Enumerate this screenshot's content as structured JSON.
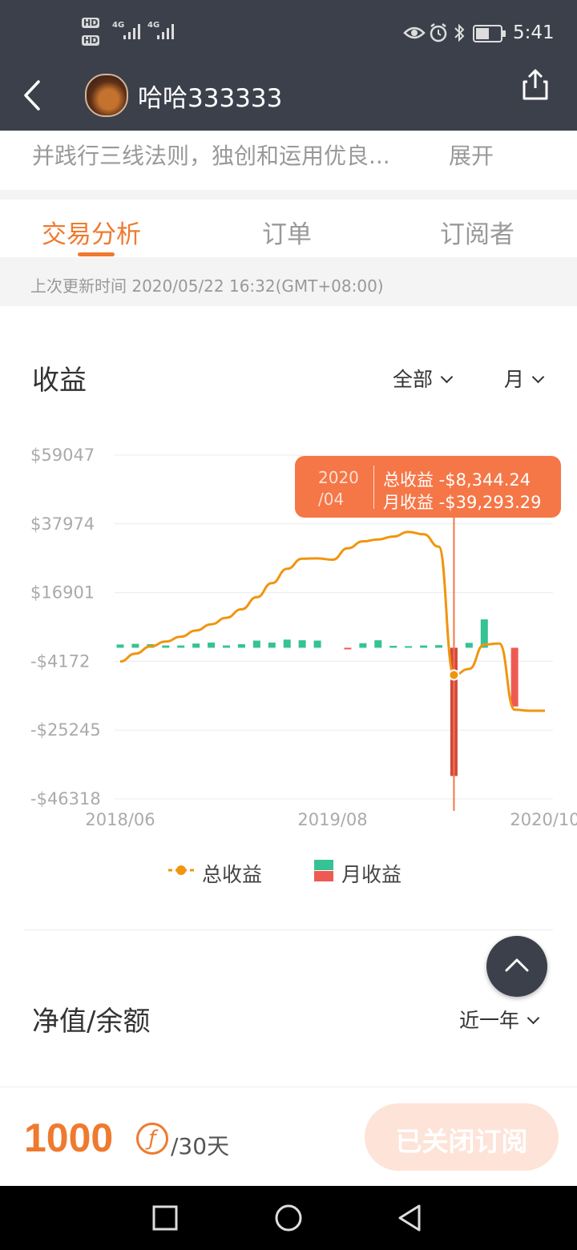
{
  "status_bar": {
    "left_indicators": [
      "HD",
      "HD",
      "4G",
      "4G"
    ],
    "time": "5:41"
  },
  "header": {
    "title": "哈哈333333"
  },
  "profile": {
    "bio_text": "并践行三线法则，独创和运用优良...",
    "expand_label": "展开"
  },
  "tabs": [
    {
      "label": "交易分析",
      "active": true
    },
    {
      "label": "订单",
      "active": false
    },
    {
      "label": "订阅者",
      "active": false
    }
  ],
  "update_info": {
    "text": "上次更新时间 2020/05/22 16:32(GMT+08:00)"
  },
  "earnings": {
    "title": "收益",
    "filter_label": "全部",
    "period_label": "月"
  },
  "colors": {
    "accent": "#ef7a2f",
    "line": "#f0950e",
    "positive": "#35c295",
    "negative": "#ee5a52",
    "header_bg": "#3c404b",
    "tooltip_bg": "#f57647"
  },
  "tooltip": {
    "date_line1": "2020",
    "date_line2": "/04",
    "total_line": "总收益 -$8,344.24",
    "monthly_line": "月收益 -$39,293.29"
  },
  "chart_data": {
    "type": "line",
    "y_ticks": [
      "$59047",
      "$37974",
      "$16901",
      "-$4172",
      "-$25245",
      "-$46318"
    ],
    "y_tick_values": [
      59047,
      37974,
      16901,
      -4172,
      -25245,
      -46318
    ],
    "ylim": [
      -46318,
      59047
    ],
    "x_ticks": [
      "2018/06",
      "2019/08",
      "2020/10"
    ],
    "grid": true,
    "legend_position": "bottom",
    "series": [
      {
        "name": "总收益",
        "kind": "line",
        "color": "#f0950e",
        "x": [
          "2018/06",
          "2018/07",
          "2018/08",
          "2018/09",
          "2018/10",
          "2018/11",
          "2018/12",
          "2019/01",
          "2019/02",
          "2019/03",
          "2019/04",
          "2019/05",
          "2019/06",
          "2019/07",
          "2019/08",
          "2019/09",
          "2019/10",
          "2019/11",
          "2019/12",
          "2020/01",
          "2020/02",
          "2020/03",
          "2020/04",
          "2020/05",
          "2020/06",
          "2020/07",
          "2020/08",
          "2020/09",
          "2020/10"
        ],
        "values": [
          -4200,
          -1800,
          400,
          1900,
          3400,
          5300,
          7200,
          9200,
          11800,
          15500,
          19800,
          24200,
          27300,
          27400,
          27000,
          30500,
          32600,
          33200,
          34100,
          35500,
          34800,
          31000,
          -8344,
          -6500,
          1000,
          1300,
          -19000,
          -19300,
          -19300
        ]
      },
      {
        "name": "月收益",
        "kind": "bar",
        "x": [
          "2018/06",
          "2018/07",
          "2018/08",
          "2018/09",
          "2018/10",
          "2018/11",
          "2018/12",
          "2019/01",
          "2019/02",
          "2019/03",
          "2019/04",
          "2019/05",
          "2019/06",
          "2019/07",
          "2019/08",
          "2019/09",
          "2019/10",
          "2019/11",
          "2019/12",
          "2020/01",
          "2020/02",
          "2020/03",
          "2020/04",
          "2020/05",
          "2020/06",
          "2020/07",
          "2020/08"
        ],
        "values": [
          1000,
          1200,
          1100,
          700,
          700,
          1300,
          1600,
          700,
          1100,
          2200,
          1600,
          2500,
          2300,
          2200,
          0,
          -400,
          1400,
          2300,
          600,
          500,
          700,
          800,
          -39293,
          1500,
          8700,
          0,
          -18000
        ]
      }
    ]
  },
  "legend": {
    "total_label": "总收益",
    "monthly_label": "月收益"
  },
  "net_value": {
    "title": "净值/余额",
    "range_label": "近一年"
  },
  "subscription": {
    "price": "1000",
    "currency_symbol": "ƒ",
    "period": "/30天",
    "button_label": "已关闭订阅"
  }
}
